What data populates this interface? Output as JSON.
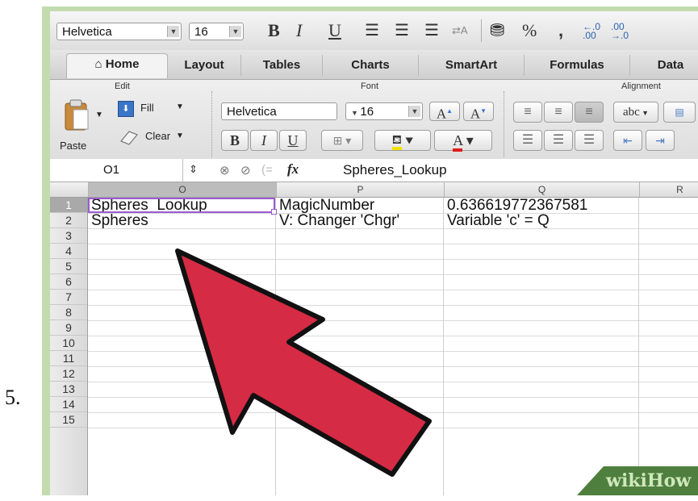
{
  "step_number": "5.",
  "format_toolbar": {
    "font_name": "Helvetica",
    "font_size": "16",
    "bold_glyph": "B",
    "italic_glyph": "I",
    "underline_glyph": "U",
    "percent_glyph": "%",
    "comma_glyph": ","
  },
  "tabs": [
    "Home",
    "Layout",
    "Tables",
    "Charts",
    "SmartArt",
    "Formulas",
    "Data"
  ],
  "ribbon": {
    "edit_group": "Edit",
    "font_group": "Font",
    "alignment_group": "Alignment",
    "paste_label": "Paste",
    "fill_label": "Fill",
    "clear_label": "Clear",
    "font_name": "Helvetica",
    "font_size": "16",
    "abc_label": "abc"
  },
  "formula_bar": {
    "name_box": "O1",
    "fx_label": "fx",
    "content": "Spheres_Lookup"
  },
  "columns": [
    "O",
    "P",
    "Q",
    "R"
  ],
  "rows": [
    "1",
    "2",
    "3",
    "4",
    "5",
    "6",
    "7",
    "8",
    "9",
    "10",
    "11",
    "12",
    "13",
    "14",
    "15"
  ],
  "cells": {
    "O1": "Spheres_Lookup",
    "P1": "MagicNumber",
    "Q1": "0.636619772367581",
    "O2": "Spheres",
    "P2": "V: Changer 'Chgr'",
    "Q2": "Variable 'c' = Q"
  },
  "watermark": "wikiHow",
  "colors": {
    "accent_arrow": "#d62b45",
    "selection": "#9b5bd0",
    "frame": "#c2dcae"
  }
}
